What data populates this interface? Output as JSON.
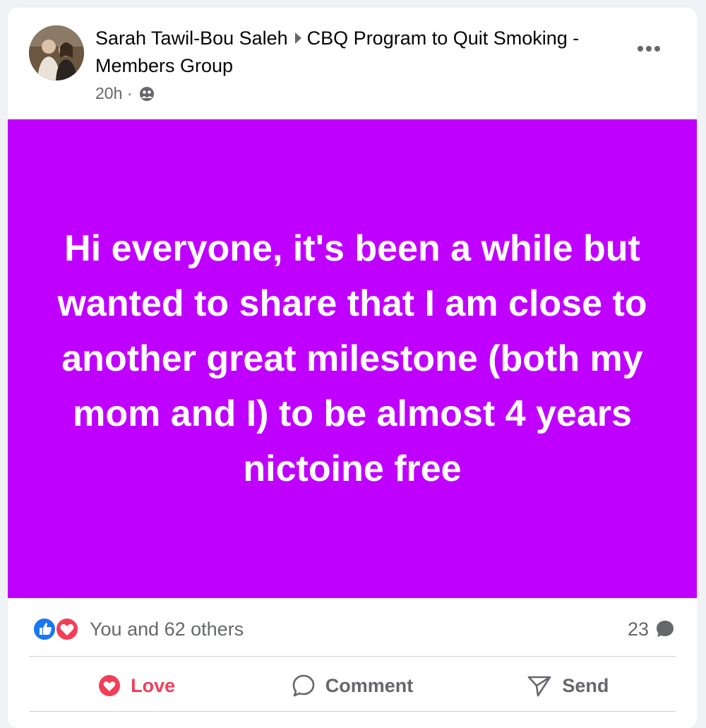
{
  "post": {
    "author": "Sarah Tawil-Bou Saleh",
    "group": "CBQ Program to Quit Smoking - Members Group",
    "time": "20h",
    "separator": "·",
    "text": "Hi everyone, it's been a while but wanted to share that I am close to another great milestone (both my mom and I) to be almost 4 years nictoine free",
    "background_color": "#c000ff"
  },
  "reactions": {
    "summary": "You and 62 others",
    "comment_count": "23",
    "icons": [
      "like-icon",
      "love-icon"
    ]
  },
  "actions": {
    "love_label": "Love",
    "comment_label": "Comment",
    "send_label": "Send"
  }
}
